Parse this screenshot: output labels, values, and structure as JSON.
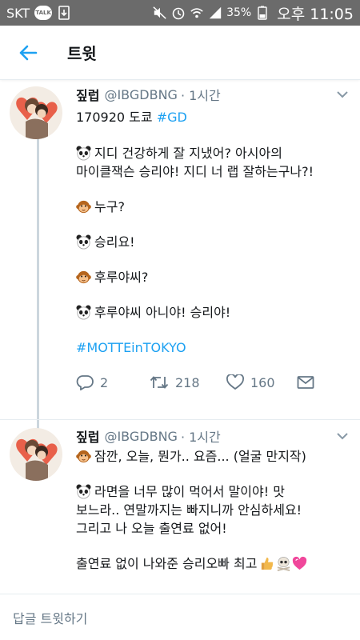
{
  "status_bar": {
    "carrier": "SKT",
    "talk_badge": "TALK",
    "battery_percent": "35%",
    "time": "오후 11:05"
  },
  "app_bar": {
    "title": "트윗"
  },
  "tweets": [
    {
      "name": "짚럽",
      "handle": "@IBGDBNG",
      "time": "· 1시간",
      "line1_text": "170920 도쿄 ",
      "line1_tag": "#GD",
      "para1": "지디 건강하게 잘 지냈어? 아시아의\n마이클잭슨 승리야! 지디 너 랩 잘하는구나?!",
      "para2": "누구?",
      "para3": "승리요!",
      "para4": "후루야씨?",
      "para5": "후루야씨 아니야! 승리야!",
      "hashtag": "#MOTTEinTOKYO",
      "reply_count": "2",
      "retweet_count": "218",
      "like_count": "160"
    },
    {
      "name": "짚럽",
      "handle": "@IBGDBNG",
      "time": "· 1시간",
      "para1": "잠깐, 오늘, 뭔가.. 요즘... (얼굴 만지작)",
      "para2": "라면을 너무 많이 먹어서 말이야! 맛\n보느라.. 연말까지는 빠지니까 안심하세요!\n그리고 나 오늘 출연료 없어!",
      "para3": "출연료 없이 나와준 승리오빠 최고"
    }
  ],
  "reply_bar": {
    "placeholder": "답글 트윗하기"
  },
  "colors": {
    "link": "#1da1f2",
    "secondary": "#657786",
    "statusbar": "#6b6b6b"
  },
  "icons": [
    "back-arrow-icon",
    "chevron-down-icon",
    "reply-icon",
    "retweet-icon",
    "heart-icon",
    "share-icon",
    "panda-emoji",
    "monkey-emoji",
    "thumbs-up-emoji",
    "skull-emoji",
    "heart-emoji"
  ]
}
